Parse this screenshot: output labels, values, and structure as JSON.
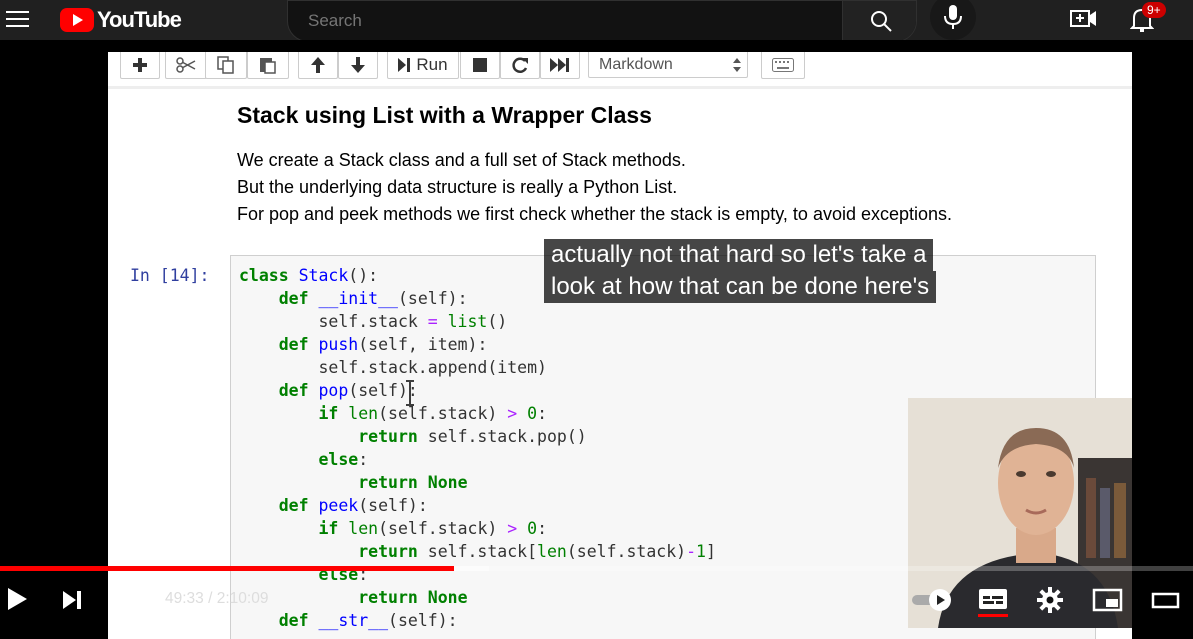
{
  "header": {
    "logo_text": "YouTube",
    "search_placeholder": "Search",
    "notification_count": "9+"
  },
  "notebook": {
    "toolbar": {
      "run_label": "Run",
      "cell_type": "Markdown"
    },
    "heading": "Stack using List with a Wrapper Class",
    "paragraphs": [
      "We create a Stack class and a full set of Stack methods.",
      "But the underlying data structure is really a Python List.",
      "For pop and peek methods we first check whether the stack is empty, to avoid exceptions."
    ],
    "cell_prompt": "In [14]:"
  },
  "captions": [
    "actually not that hard so let's take a",
    "look at how that can be done here's"
  ],
  "player": {
    "current_time": "49:33",
    "separator": "/",
    "duration": "2:10:09",
    "progress_fraction": 0.3808,
    "buffered_fraction": 0.41,
    "progress_color": "#ff0000",
    "icons": [
      "play-icon",
      "next-icon",
      "volume-icon",
      "autoplay-toggle-icon",
      "subtitles-icon",
      "settings-icon",
      "miniplayer-icon",
      "theater-icon"
    ]
  }
}
